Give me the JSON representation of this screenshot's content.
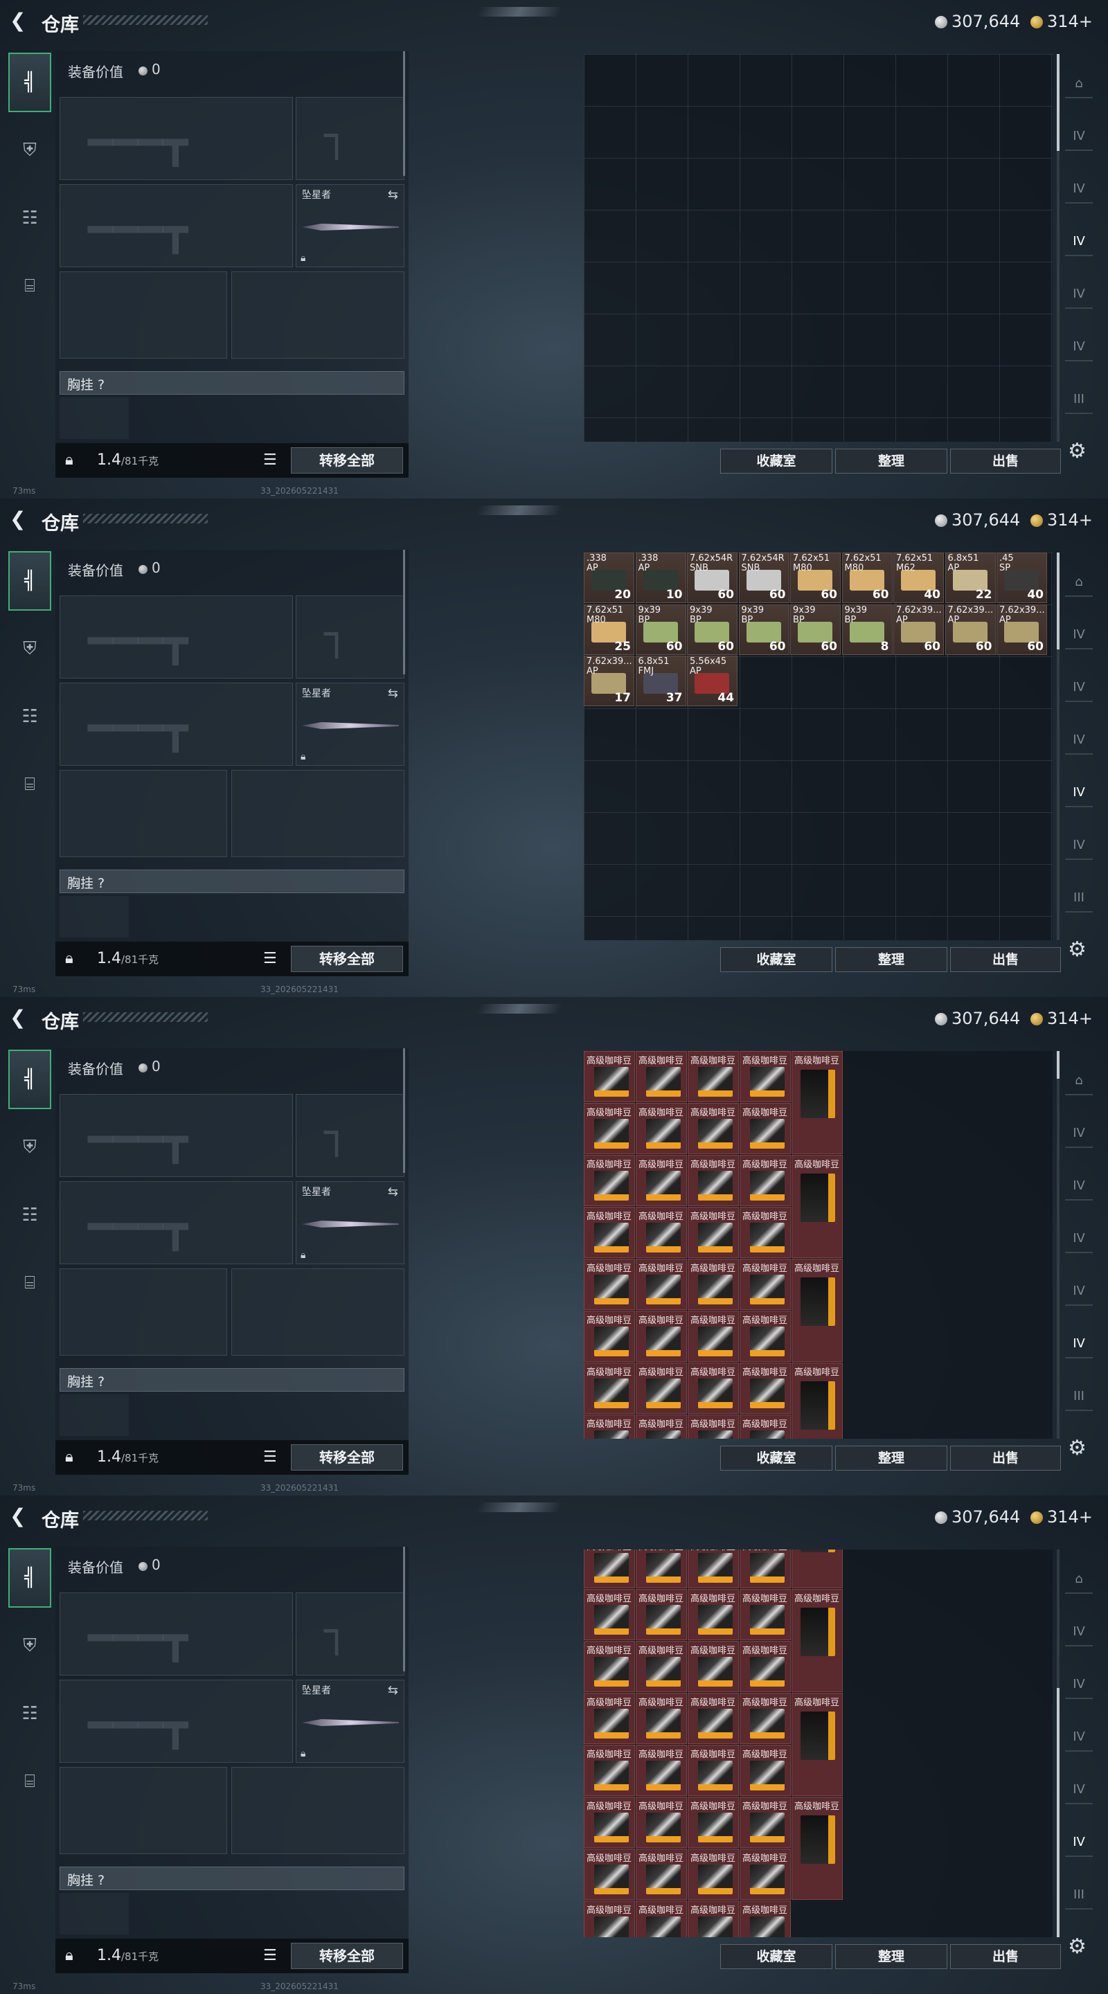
{
  "header": {
    "back_icon": "chevron-left-icon",
    "title": "仓库"
  },
  "currency": {
    "silver": "307,644",
    "gold": "314+"
  },
  "equipment": {
    "value_label": "装备价值",
    "value": "0",
    "melee_name": "坠星者",
    "rig_label": "胸挂 ?",
    "weight": "1.4",
    "weight_capacity": "/81千克",
    "transfer_label": "转移全部"
  },
  "actions": {
    "collection": "收藏室",
    "sort": "整理",
    "sell": "出售"
  },
  "status": {
    "ping": "73ms",
    "build": "33_202605221431"
  },
  "ammo": [
    {
      "name": ".338\nAP",
      "count": "20",
      "color": "#2f3a34"
    },
    {
      "name": ".338\nAP",
      "count": "10",
      "color": "#2f3a34"
    },
    {
      "name": "7.62x54R\nSNB",
      "count": "60",
      "color": "#c8c8c8"
    },
    {
      "name": "7.62x54R\nSNB",
      "count": "60",
      "color": "#c8c8c8"
    },
    {
      "name": "7.62x51\nM80",
      "count": "60",
      "color": "#d8b070"
    },
    {
      "name": "7.62x51\nM80",
      "count": "60",
      "color": "#d8b070"
    },
    {
      "name": "7.62x51\nM62",
      "count": "40",
      "color": "#d8b070"
    },
    {
      "name": "6.8x51\nAP",
      "count": "22",
      "color": "#c8b890"
    },
    {
      "name": ".45\nSP",
      "count": "40",
      "color": "#3a3a3a"
    },
    {
      "name": "7.62x51\nM80",
      "count": "25",
      "color": "#d8b070"
    },
    {
      "name": "9x39\nBP",
      "count": "60",
      "color": "#9cb070"
    },
    {
      "name": "9x39\nBP",
      "count": "60",
      "color": "#9cb070"
    },
    {
      "name": "9x39\nBP",
      "count": "60",
      "color": "#9cb070"
    },
    {
      "name": "9x39\nBP",
      "count": "60",
      "color": "#9cb070"
    },
    {
      "name": "9x39\nBP",
      "count": "8",
      "color": "#9cb070"
    },
    {
      "name": "7.62x39...\nAP",
      "count": "60",
      "color": "#b0a070"
    },
    {
      "name": "7.62x39...\nAP",
      "count": "60",
      "color": "#b0a070"
    },
    {
      "name": "7.62x39...\nAP",
      "count": "60",
      "color": "#b0a070"
    },
    {
      "name": "7.62x39...\nAP",
      "count": "17",
      "color": "#b0a070"
    },
    {
      "name": "6.8x51\nFMJ",
      "count": "37",
      "color": "#4a4a5a"
    },
    {
      "name": "5.56x45\nAP",
      "count": "44",
      "color": "#9a3030"
    }
  ],
  "coffee": {
    "label": "高级咖啡豆"
  }
}
